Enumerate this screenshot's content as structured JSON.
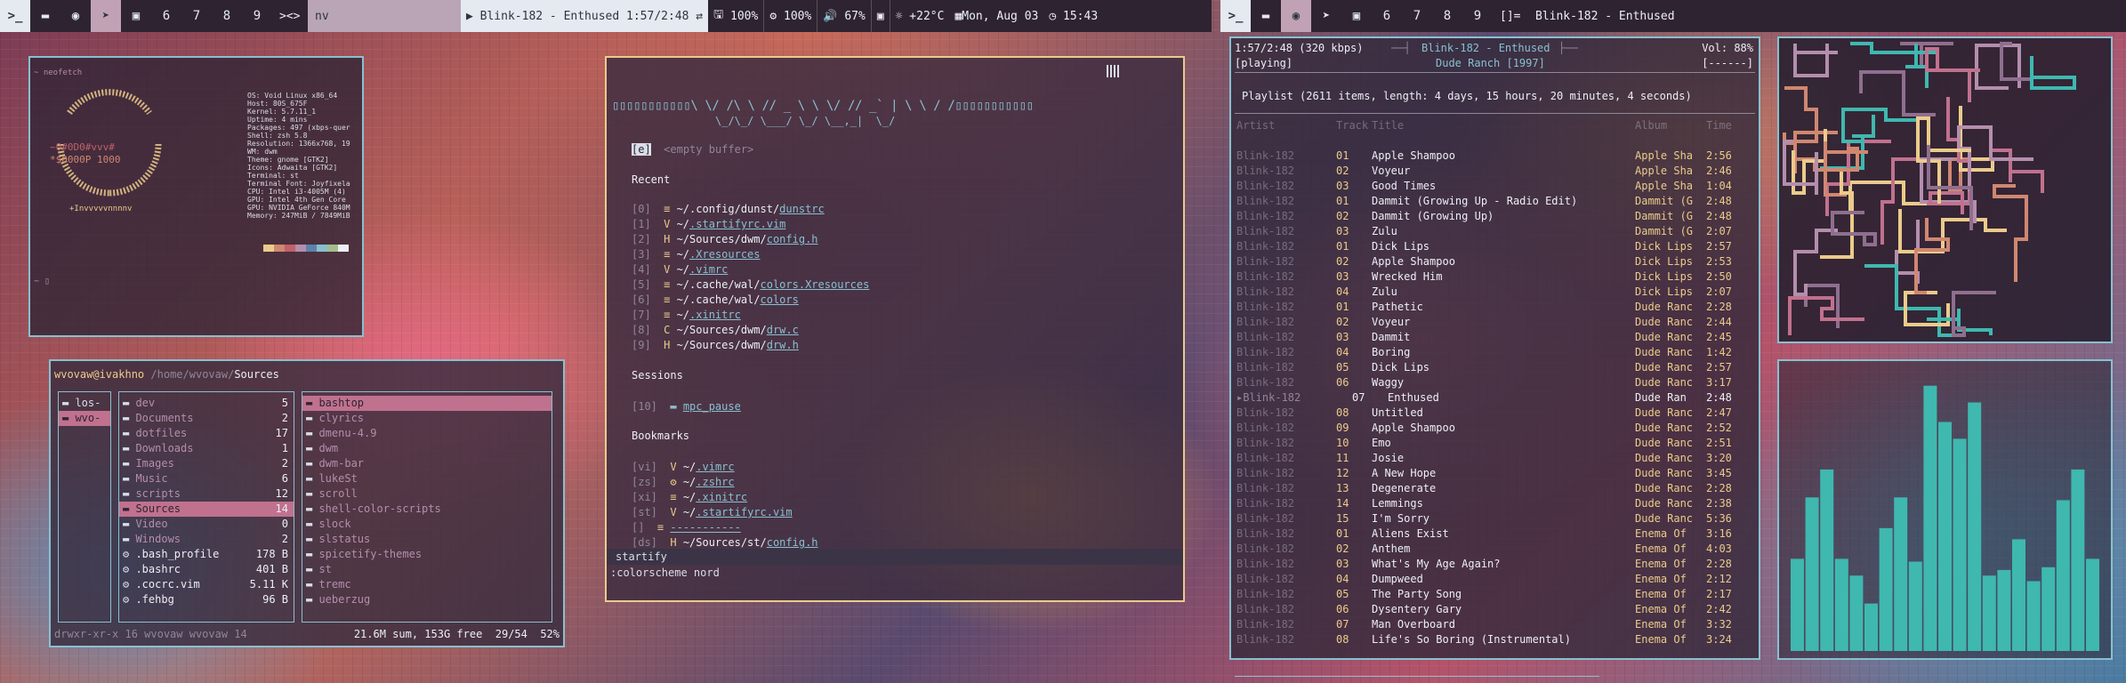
{
  "colors": {
    "accent": "#88c0d0",
    "focus": "#ebcb8b",
    "bar_bg": "#2e2431",
    "visualizer": "#3fb8af"
  },
  "left_bar": {
    "icons": [
      {
        "name": "terminal-icon",
        "glyph": ">_"
      },
      {
        "name": "folder-icon",
        "glyph": "▬"
      },
      {
        "name": "spotify-icon",
        "glyph": "◉"
      },
      {
        "name": "telegram-icon",
        "glyph": "➤"
      },
      {
        "name": "chat-icon",
        "glyph": "▣"
      },
      {
        "name": "tag-6-icon",
        "glyph": "6"
      },
      {
        "name": "tag-7-icon",
        "glyph": "7"
      },
      {
        "name": "tag-8-icon",
        "glyph": "8"
      },
      {
        "name": "tag-9-icon",
        "glyph": "9"
      }
    ],
    "layout": "><>",
    "window_title": "nv",
    "now_playing": "Blink-182 - Enthused 1:57/2:48",
    "shuffle": "⇄",
    "disk": "100%",
    "cpu": "100%",
    "volume": "67%",
    "weather": "+22°C",
    "date": "Mon, Aug 03",
    "time": "15:43"
  },
  "right_bar": {
    "layout": "[]=",
    "window_title": "Blink-182 - Enthused"
  },
  "neofetch": {
    "prompt": "~ neofetch",
    "prompt2": "~ ▯",
    "info": [
      "OS: Void Linux x86_64",
      "Host: 80S_675F",
      "Kernel: 5.7.11_1",
      "Uptime: 4 mins",
      "Packages: 497 (xbps-quer",
      "Shell: zsh 5.8",
      "Resolution: 1366x768, 19",
      "WM: dwm",
      "Theme: gnome [GTK2]",
      "Icons: Adwaita [GTK2]",
      "Terminal: st",
      "Terminal Font: Joyfixela",
      "CPU: Intel i3-4005M (4)",
      "GPU: Intel 4th Gen Core",
      "GPU: NVIDIA GeForce 840M",
      "Memory: 247MiB / 7849MiB"
    ],
    "palette": [
      "#ebcb8b",
      "#d08770",
      "#bf616a",
      "#b48ead",
      "#5e81ac",
      "#88c0d0",
      "#a3be8c",
      "#eceff4"
    ]
  },
  "ranger": {
    "header_user": "wvovaw@ivakhno",
    "header_path": "/home/wvovaw/",
    "header_dir": "Sources",
    "col1": [
      "los-",
      "wvo-"
    ],
    "col2": [
      {
        "n": "dev",
        "s": "5"
      },
      {
        "n": "Documents",
        "s": "2"
      },
      {
        "n": "dotfiles",
        "s": "17"
      },
      {
        "n": "Downloads",
        "s": "1"
      },
      {
        "n": "Images",
        "s": "2"
      },
      {
        "n": "Music",
        "s": "6"
      },
      {
        "n": "scripts",
        "s": "12"
      },
      {
        "n": "Sources",
        "s": "14"
      },
      {
        "n": "Video",
        "s": "0"
      },
      {
        "n": "Windows",
        "s": "2"
      },
      {
        "n": ".bash_profile",
        "s": "178 B"
      },
      {
        "n": ".bashrc",
        "s": "401 B"
      },
      {
        "n": ".cocrc.vim",
        "s": "5.11 K"
      },
      {
        "n": ".fehbg",
        "s": "96 B"
      }
    ],
    "col3": [
      "bashtop",
      "clyrics",
      "dmenu-4.9",
      "dwm",
      "dwm-bar",
      "lukeSt",
      "scroll",
      "shell-color-scripts",
      "slock",
      "slstatus",
      "spicetify-themes",
      "st",
      "tremc",
      "ueberzug"
    ],
    "status_left": "drwxr-xr-x 16 wvovaw wvovaw 14",
    "status_right": "21.6M sum, 153G free  29/54  52%"
  },
  "nvim": {
    "banner": "▯▯▯▯▯▯▯▯▯▯▯\\ \\/ /\\ \\ // _ \\ \\ \\/ // _` | \\ \\ / /▯▯▯▯▯▯▯▯▯▯▯",
    "banner2": "\\_/\\_/ \\___/ \\_/ \\__,_|  \\_/",
    "empty_key": "[e]",
    "empty_label": "<empty buffer>",
    "recent_title": "Recent",
    "recent": [
      {
        "k": "[0]",
        "i": "≡",
        "pre": "~/.config/dunst/",
        "f": "dunstrc"
      },
      {
        "k": "[1]",
        "i": "V",
        "pre": "~/",
        "f": ".startifyrc.vim"
      },
      {
        "k": "[2]",
        "i": "H",
        "pre": "~/Sources/dwm/",
        "f": "config.h"
      },
      {
        "k": "[3]",
        "i": "≡",
        "pre": "~/",
        "f": ".Xresources"
      },
      {
        "k": "[4]",
        "i": "V",
        "pre": "~/",
        "f": ".vimrc"
      },
      {
        "k": "[5]",
        "i": "≡",
        "pre": "~/.cache/wal/",
        "f": "colors.Xresources"
      },
      {
        "k": "[6]",
        "i": "≡",
        "pre": "~/.cache/wal/",
        "f": "colors"
      },
      {
        "k": "[7]",
        "i": "≡",
        "pre": "~/",
        "f": ".xinitrc"
      },
      {
        "k": "[8]",
        "i": "C",
        "pre": "~/Sources/dwm/",
        "f": "drw.c"
      },
      {
        "k": "[9]",
        "i": "H",
        "pre": "~/Sources/dwm/",
        "f": "drw.h"
      }
    ],
    "sessions_title": "Sessions",
    "sessions": [
      {
        "k": "[10]",
        "f": "mpc_pause"
      }
    ],
    "bookmarks_title": "Bookmarks",
    "bookmarks": [
      {
        "k": "[vi]",
        "i": "V",
        "pre": "~/",
        "f": ".vimrc"
      },
      {
        "k": "[zs]",
        "i": "⚙",
        "pre": "~/",
        "f": ".zshrc"
      },
      {
        "k": "[xi]",
        "i": "≡",
        "pre": "~/",
        "f": ".xinitrc"
      },
      {
        "k": "[st]",
        "i": "V",
        "pre": "~/",
        "f": ".startifyrc.vim"
      },
      {
        "k": "[]",
        "i": "≡",
        "pre": "",
        "f": "-----------"
      },
      {
        "k": "[ds]",
        "i": "H",
        "pre": "~/Sources/st/",
        "f": "config.h"
      }
    ],
    "statusline": "startify",
    "cmdline": ":colorscheme nord"
  },
  "ncmpcpp": {
    "time": "1:57/2:48 (320 kbps)",
    "now": "Blink-182 - Enthused",
    "album_line": "Dude Ranch [1997]",
    "vol": "Vol: 88%",
    "state": "[playing]",
    "flags": "[------]",
    "playlist_info": "Playlist (2611 items, length: 4 days, 15 hours, 20 minutes, 4 seconds)",
    "headers": {
      "artist": "Artist",
      "track": "Track",
      "title": "Title",
      "album": "Album",
      "time": "Time"
    },
    "rows": [
      {
        "a": "Blink-182",
        "n": "01",
        "t": "Apple Shampoo",
        "al": "Apple Sha",
        "tm": "2:56"
      },
      {
        "a": "Blink-182",
        "n": "02",
        "t": "Voyeur",
        "al": "Apple Sha",
        "tm": "2:46"
      },
      {
        "a": "Blink-182",
        "n": "03",
        "t": "Good Times",
        "al": "Apple Sha",
        "tm": "1:04"
      },
      {
        "a": "Blink-182",
        "n": "01",
        "t": "Dammit (Growing Up - Radio Edit)",
        "al": "Dammit (G",
        "tm": "2:48"
      },
      {
        "a": "Blink-182",
        "n": "02",
        "t": "Dammit (Growing Up)",
        "al": "Dammit (G",
        "tm": "2:48"
      },
      {
        "a": "Blink-182",
        "n": "03",
        "t": "Zulu",
        "al": "Dammit (G",
        "tm": "2:07"
      },
      {
        "a": "Blink-182",
        "n": "01",
        "t": "Dick Lips",
        "al": "Dick Lips",
        "tm": "2:57"
      },
      {
        "a": "Blink-182",
        "n": "02",
        "t": "Apple Shampoo",
        "al": "Dick Lips",
        "tm": "2:53"
      },
      {
        "a": "Blink-182",
        "n": "03",
        "t": "Wrecked Him",
        "al": "Dick Lips",
        "tm": "2:50"
      },
      {
        "a": "Blink-182",
        "n": "04",
        "t": "Zulu",
        "al": "Dick Lips",
        "tm": "2:07"
      },
      {
        "a": "Blink-182",
        "n": "01",
        "t": "Pathetic",
        "al": "Dude Ranc",
        "tm": "2:28"
      },
      {
        "a": "Blink-182",
        "n": "02",
        "t": "Voyeur",
        "al": "Dude Ranc",
        "tm": "2:44"
      },
      {
        "a": "Blink-182",
        "n": "03",
        "t": "Dammit",
        "al": "Dude Ranc",
        "tm": "2:45"
      },
      {
        "a": "Blink-182",
        "n": "04",
        "t": "Boring",
        "al": "Dude Ranc",
        "tm": "1:42"
      },
      {
        "a": "Blink-182",
        "n": "05",
        "t": "Dick Lips",
        "al": "Dude Ranc",
        "tm": "2:57"
      },
      {
        "a": "Blink-182",
        "n": "06",
        "t": "Waggy",
        "al": "Dude Ranc",
        "tm": "3:17"
      },
      {
        "a": "▸Blink-182",
        "n": "07",
        "t": "Enthused",
        "al": "Dude Ran",
        "tm": "2:48",
        "playing": true
      },
      {
        "a": "Blink-182",
        "n": "08",
        "t": "Untitled",
        "al": "Dude Ranc",
        "tm": "2:47"
      },
      {
        "a": "Blink-182",
        "n": "09",
        "t": "Apple Shampoo",
        "al": "Dude Ranc",
        "tm": "2:52"
      },
      {
        "a": "Blink-182",
        "n": "10",
        "t": "Emo",
        "al": "Dude Ranc",
        "tm": "2:51"
      },
      {
        "a": "Blink-182",
        "n": "11",
        "t": "Josie",
        "al": "Dude Ranc",
        "tm": "3:20"
      },
      {
        "a": "Blink-182",
        "n": "12",
        "t": "A New Hope",
        "al": "Dude Ranc",
        "tm": "3:45"
      },
      {
        "a": "Blink-182",
        "n": "13",
        "t": "Degenerate",
        "al": "Dude Ranc",
        "tm": "2:28"
      },
      {
        "a": "Blink-182",
        "n": "14",
        "t": "Lemmings",
        "al": "Dude Ranc",
        "tm": "2:38"
      },
      {
        "a": "Blink-182",
        "n": "15",
        "t": "I'm Sorry",
        "al": "Dude Ranc",
        "tm": "5:36"
      },
      {
        "a": "Blink-182",
        "n": "01",
        "t": "Aliens Exist",
        "al": "Enema Of",
        "tm": "3:16"
      },
      {
        "a": "Blink-182",
        "n": "02",
        "t": "Anthem",
        "al": "Enema Of",
        "tm": "4:03"
      },
      {
        "a": "Blink-182",
        "n": "03",
        "t": "What's My Age Again?",
        "al": "Enema Of",
        "tm": "2:28"
      },
      {
        "a": "Blink-182",
        "n": "04",
        "t": "Dumpweed",
        "al": "Enema Of",
        "tm": "2:12"
      },
      {
        "a": "Blink-182",
        "n": "05",
        "t": "The Party Song",
        "al": "Enema Of",
        "tm": "2:17"
      },
      {
        "a": "Blink-182",
        "n": "06",
        "t": "Dysentery Gary",
        "al": "Enema Of",
        "tm": "2:42"
      },
      {
        "a": "Blink-182",
        "n": "07",
        "t": "Man Overboard",
        "al": "Enema Of",
        "tm": "3:32"
      },
      {
        "a": "Blink-182",
        "n": "08",
        "t": "Life's So Boring (Instrumental)",
        "al": "Enema Of",
        "tm": "3:24"
      }
    ],
    "progress": 0.7
  },
  "visualizer": {
    "levels": [
      0.33,
      0.55,
      0.65,
      0.33,
      0.27,
      0.17,
      0.44,
      0.55,
      0.32,
      0.95,
      0.82,
      0.76,
      0.89,
      0.27,
      0.29,
      0.4,
      0.25,
      0.3,
      0.54,
      0.65,
      0.33
    ]
  }
}
